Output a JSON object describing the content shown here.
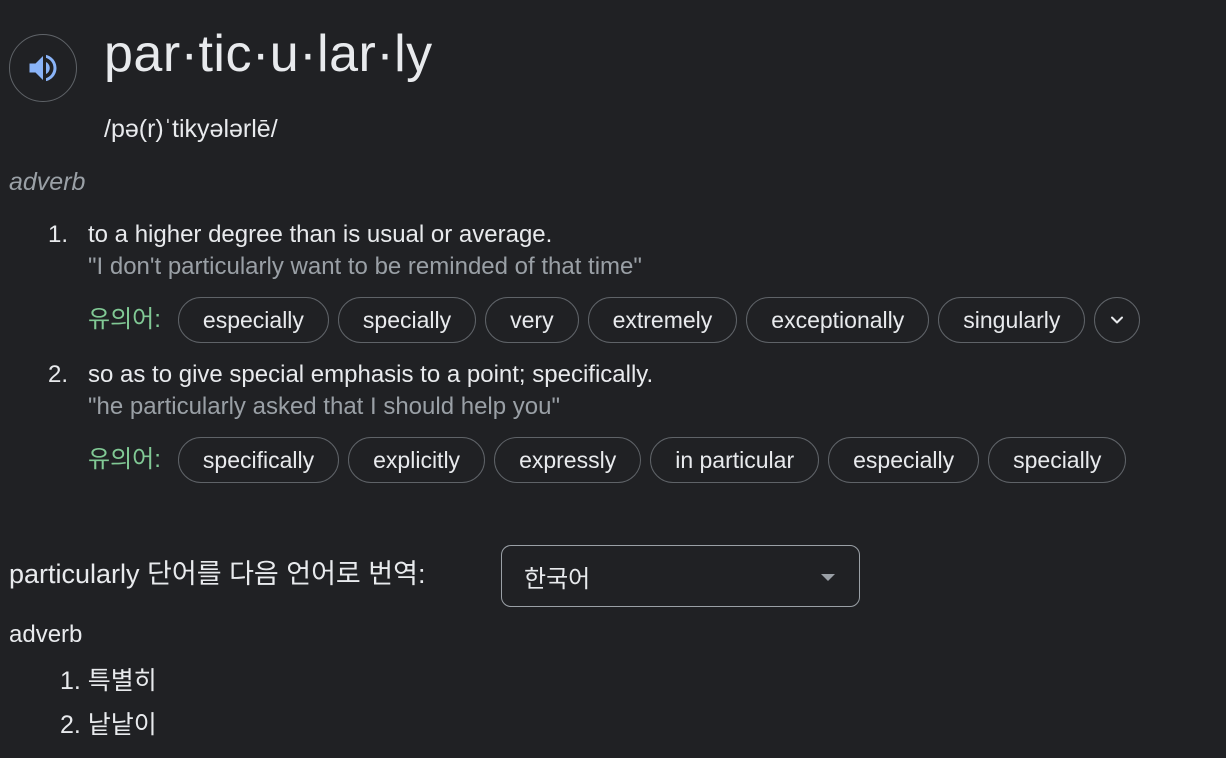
{
  "entry": {
    "headword": "par·tic·u·lar·ly",
    "phonetic": "/pə(r)ˈtikyələrlē/",
    "part_of_speech": "adverb",
    "senses": [
      {
        "number": "1.",
        "definition": "to a higher degree than is usual or average.",
        "example": "\"I don't particularly want to be reminded of that time\"",
        "synonyms_label": "유의어:",
        "synonyms": [
          "especially",
          "specially",
          "very",
          "extremely",
          "exceptionally",
          "singularly"
        ],
        "has_more": true
      },
      {
        "number": "2.",
        "definition": "so as to give special emphasis to a point; specifically.",
        "example": "\"he particularly asked that I should help you\"",
        "synonyms_label": "유의어:",
        "synonyms": [
          "specifically",
          "explicitly",
          "expressly",
          "in particular",
          "especially",
          "specially"
        ],
        "has_more": false
      }
    ]
  },
  "translation": {
    "label": "particularly 단어를 다음 언어로 번역:",
    "selected_language": "한국어",
    "part_of_speech": "adverb",
    "items": [
      "1. 특별히",
      "2. 낱낱이"
    ]
  },
  "icons": {
    "speaker": "speaker-icon",
    "more": "chevron-down-icon",
    "dropdown": "dropdown-caret-icon"
  },
  "colors": {
    "background": "#202124",
    "text": "#e8eaed",
    "muted": "#9aa0a6",
    "synonym_label": "#81c995",
    "speaker_icon": "#8ab4f8"
  }
}
